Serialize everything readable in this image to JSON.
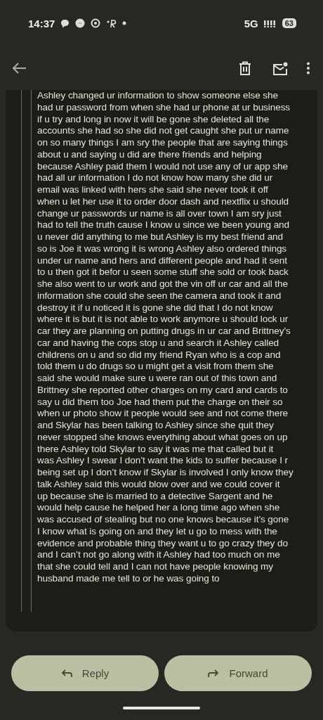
{
  "status_bar": {
    "time": "14:37",
    "network": "5G",
    "battery": "63"
  },
  "message": {
    "lines": [
      "Ashley changed ur information to show someone else she",
      "had ur password from when she had ur phone at ur business",
      "if u try and long in now it will be gone she deleted all the",
      "accounts she had so she did not get caught she put ur name",
      "on so many things I am sry the people that are saying things",
      "about u and saying u did are there friends and helping",
      "because Ashley paid them I would not use any of ur app she",
      "had all ur information I do not know how many she did ur",
      "email was linked with hers she said she never took it off",
      "when u let her use it to order door dash and nextflix u should",
      "change ur passwords ur name is all over town I am sry just",
      "had to tell the truth cause I know u since we been young and",
      "u never did anything to me but Ashley is my best friend and",
      "so is Joe it was wrong it is wrong Ashley also ordered things",
      "under ur name and hers and different people and had it sent",
      "to u then got it befor u seen some stuff she sold or took back",
      "she also went to ur work and got the vin off ur car and all the",
      "information she could she seen the camera and took it and",
      "destroy it if u noticed it is gone she did that I do not know",
      "where it is but it is not able to work anymore u should lock ur",
      "car they are planning on putting drugs in ur car and Brittney’s",
      "car and having the cops stop u and search it Ashley called",
      "childrens on u and so did my friend Ryan who is a cop and",
      "told them u do drugs so u might get a visit from them she",
      "said she would make sure u were ran out of this town and",
      "Brittney she reported other charges on my card and cards to",
      "say u did them too Joe had them put the charge on their so",
      "when ur photo show it people would see and not come there",
      "and Skylar has been talking to Ashley since she quit they",
      "never stopped she knows everything about what goes on up",
      "there Ashley told Skylar to say it was me that called but it",
      "was Ashley I swear I don’t want the kids to suffer because I r",
      "being set up I don’t know if Skylar is involved I only know they",
      "talk Ashley said this would blow over and we could cover it",
      "up because she is married to a detective Sargent and he",
      "would help cause he helped her a long time ago when she",
      "was accused of stealing but no one knows because it’s gone",
      "I know what is going on and they let u go to mess with the",
      "evidence and probable thing they want u to go crazy they do",
      "and I can’t not go along with it Ashley had too much on me",
      "that she could tell and I can not have people knowing my",
      "husband made me tell to or he was going to"
    ]
  },
  "actions": [
    {
      "kind": "reply",
      "label": "Reply"
    },
    {
      "kind": "forward",
      "label": "Forward"
    }
  ]
}
